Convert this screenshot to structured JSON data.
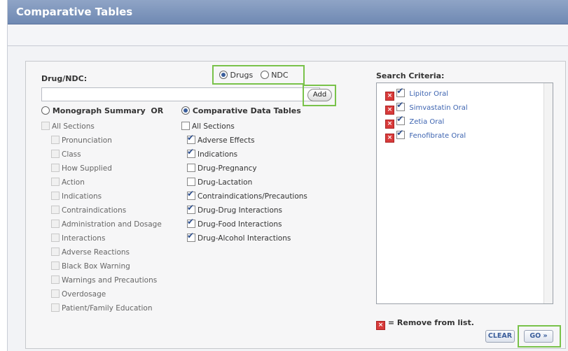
{
  "window": {
    "title": "Comparative Tables"
  },
  "drug": {
    "label": "Drug/NDC:",
    "input_value": "",
    "mode_drugs": "Drugs",
    "mode_ndc": "NDC",
    "add_label": "Add"
  },
  "sections": {
    "monograph_label": "Monograph Summary",
    "or_label": "OR",
    "comparative_label": "Comparative Data Tables",
    "monograph_items": [
      "All Sections",
      "Pronunciation",
      "Class",
      "How Supplied",
      "Action",
      "Indications",
      "Contraindications",
      "Administration and Dosage",
      "Interactions",
      "Adverse Reactions",
      "Black Box Warning",
      "Warnings and Precautions",
      "Overdosage",
      "Patient/Family Education"
    ],
    "comparative_items": [
      "All Sections",
      "Adverse Effects",
      "Indications",
      "Drug-Pregnancy",
      "Drug-Lactation",
      "Contraindications/Precautions",
      "Drug-Drug Interactions",
      "Drug-Food Interactions",
      "Drug-Alcohol Interactions"
    ]
  },
  "criteria": {
    "label": "Search Criteria:",
    "items": [
      "Lipitor Oral",
      "Simvastatin Oral",
      "Zetia Oral",
      "Fenofibrate Oral"
    ],
    "legend": "= Remove from list."
  },
  "buttons": {
    "clear": "CLEAR",
    "go": "GO »"
  },
  "colors": {
    "titlebar": "#6f89b3",
    "highlight": "#79c24a",
    "link": "#3c63b0",
    "remove": "#d83b3b"
  }
}
